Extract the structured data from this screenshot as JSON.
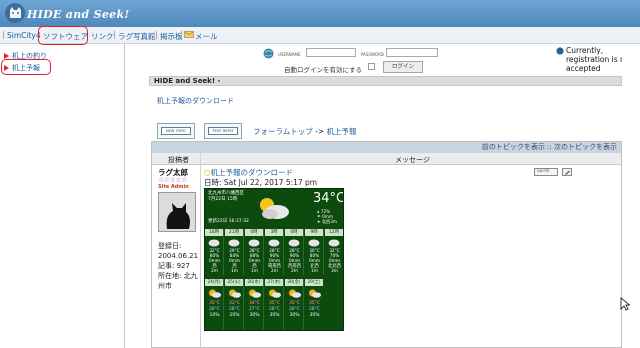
{
  "site": {
    "title": "HIDE and Seek!"
  },
  "nav": {
    "items": [
      "SimCity4",
      "ソフトウェア",
      "リンク",
      "ラグ写真館",
      "掲示板",
      "メール"
    ]
  },
  "sidebar": {
    "items": [
      "机上の釣り",
      "机上予報"
    ]
  },
  "login": {
    "username_label": "USERNAME",
    "password_label": "PASSWORD",
    "autologin_label": "自動ログインを有効にする",
    "login_button": "ログイン"
  },
  "notice": {
    "text": "Currently, registration is not accepted"
  },
  "content": {
    "section_header": "HIDE and Seek! -",
    "topic_title": "机上予報のダウンロード",
    "new_topic_button": "NEW TOPIC",
    "reply_button": "POST REPLY",
    "breadcrumb_home": "フォーラムトップ",
    "breadcrumb_arrow": "->",
    "breadcrumb_forum": "机上予報",
    "topic_nav": "前のトピックを表示 :: 次のトピックを表示",
    "col_author": "投稿者",
    "col_message": "メッセージ"
  },
  "post": {
    "author": "ラグ太郎",
    "stars": "☆☆☆☆☆",
    "rank": "Site Admin",
    "reg_label": "登録日:",
    "reg_date": "2004.06.21",
    "posts_label": "記事:",
    "posts_count": "927",
    "location_label": "所在地:",
    "location": "北九州市",
    "title": "机上予報のダウンロード",
    "date_label": "日時:",
    "date": "Sat Jul 22, 2017 5:17 pm",
    "quote_button": "QUOTE"
  },
  "weather": {
    "location": "北九州市八幡西区",
    "date": "7月22日 15時",
    "updated": "更新22日 16:37:32",
    "temperature": "34°C",
    "humidity": "72%",
    "rain": "0mm",
    "wind": "北西3m",
    "hourly": [
      {
        "time": "18時",
        "temp": "32°C",
        "humidity": "80%",
        "rain": "0mm",
        "wind_dir": "西",
        "wind_speed": "2m"
      },
      {
        "time": "21時",
        "temp": "29°C",
        "humidity": "84%",
        "rain": "0mm",
        "wind_dir": "西",
        "wind_speed": "1m"
      },
      {
        "time": "0時",
        "temp": "28°C",
        "humidity": "88%",
        "rain": "0mm",
        "wind_dir": "西",
        "wind_speed": "1m"
      },
      {
        "time": "3時",
        "temp": "28°C",
        "humidity": "90%",
        "rain": "0mm",
        "wind_dir": "南南西",
        "wind_speed": "2m"
      },
      {
        "time": "6時",
        "temp": "28°C",
        "humidity": "90%",
        "rain": "0mm",
        "wind_dir": "西南西",
        "wind_speed": "2m"
      },
      {
        "time": "9時",
        "temp": "30°C",
        "humidity": "80%",
        "rain": "0mm",
        "wind_dir": "北西",
        "wind_speed": "1m"
      },
      {
        "time": "12時",
        "temp": "32°C",
        "humidity": "70%",
        "rain": "0mm",
        "wind_dir": "北北西",
        "wind_speed": "3m"
      }
    ],
    "daily": [
      {
        "date": "24(月)",
        "high": "35°C",
        "low": "28°C",
        "pop": "10%"
      },
      {
        "date": "25(火)",
        "high": "33°C",
        "low": "28°C",
        "pop": "20%"
      },
      {
        "date": "26(水)",
        "high": "34°C",
        "low": "27°C",
        "pop": "30%"
      },
      {
        "date": "27(木)",
        "high": "35°C",
        "low": "28°C",
        "pop": "30%"
      },
      {
        "date": "28(金)",
        "high": "35°C",
        "low": "28°C",
        "pop": "30%"
      },
      {
        "date": "29(土)",
        "high": "35°C",
        "low": "28°C",
        "pop": "30%"
      }
    ]
  },
  "colors": {
    "banner": "#4f87bb",
    "link": "#1c5fa0",
    "highlight": "#e0202a",
    "weather_bg": "#0d4a0d"
  }
}
